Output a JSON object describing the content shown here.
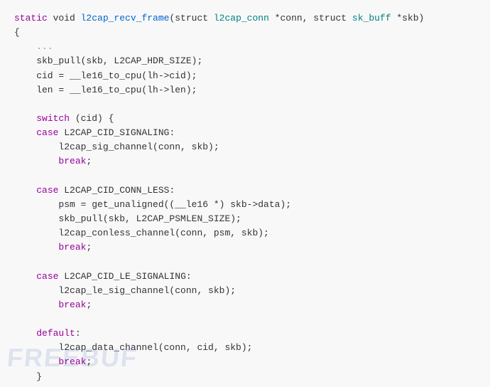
{
  "code": {
    "lines": [
      {
        "tokens": [
          {
            "text": "static",
            "class": "kw-purple"
          },
          {
            "text": " void ",
            "class": "plain"
          },
          {
            "text": "l2cap_recv_frame",
            "class": "func"
          },
          {
            "text": "(struct ",
            "class": "plain"
          },
          {
            "text": "l2cap_conn",
            "class": "type"
          },
          {
            "text": " *conn, struct ",
            "class": "plain"
          },
          {
            "text": "sk_buff",
            "class": "type"
          },
          {
            "text": " *skb)",
            "class": "plain"
          }
        ]
      },
      {
        "tokens": [
          {
            "text": "{",
            "class": "plain"
          }
        ]
      },
      {
        "tokens": [
          {
            "text": "    ...",
            "class": "comment"
          }
        ]
      },
      {
        "tokens": [
          {
            "text": "    skb_pull(skb, L2CAP_HDR_SIZE);",
            "class": "plain"
          }
        ]
      },
      {
        "tokens": [
          {
            "text": "    cid = __le16_to_cpu(lh->cid);",
            "class": "plain"
          }
        ]
      },
      {
        "tokens": [
          {
            "text": "    len = __le16_to_cpu(lh->len);",
            "class": "plain"
          }
        ]
      },
      {
        "tokens": []
      },
      {
        "tokens": [
          {
            "text": "    ",
            "class": "plain"
          },
          {
            "text": "switch",
            "class": "kw-purple"
          },
          {
            "text": " (cid) {",
            "class": "plain"
          }
        ]
      },
      {
        "tokens": [
          {
            "text": "    ",
            "class": "plain"
          },
          {
            "text": "case",
            "class": "kw-purple"
          },
          {
            "text": " L2CAP_CID_SIGNALING:",
            "class": "plain"
          }
        ]
      },
      {
        "tokens": [
          {
            "text": "        l2cap_sig_channel(conn, skb);",
            "class": "plain"
          }
        ]
      },
      {
        "tokens": [
          {
            "text": "        ",
            "class": "plain"
          },
          {
            "text": "break",
            "class": "kw-purple"
          },
          {
            "text": ";",
            "class": "plain"
          }
        ]
      },
      {
        "tokens": []
      },
      {
        "tokens": [
          {
            "text": "    ",
            "class": "plain"
          },
          {
            "text": "case",
            "class": "kw-purple"
          },
          {
            "text": " L2CAP_CID_CONN_LESS:",
            "class": "plain"
          }
        ]
      },
      {
        "tokens": [
          {
            "text": "        psm = get_unaligned((__le16 *) skb->data);",
            "class": "plain"
          }
        ]
      },
      {
        "tokens": [
          {
            "text": "        skb_pull(skb, L2CAP_PSMLEN_SIZE);",
            "class": "plain"
          }
        ]
      },
      {
        "tokens": [
          {
            "text": "        l2cap_conless_channel(conn, psm, skb);",
            "class": "plain"
          }
        ]
      },
      {
        "tokens": [
          {
            "text": "        ",
            "class": "plain"
          },
          {
            "text": "break",
            "class": "kw-purple"
          },
          {
            "text": ";",
            "class": "plain"
          }
        ]
      },
      {
        "tokens": []
      },
      {
        "tokens": [
          {
            "text": "    ",
            "class": "plain"
          },
          {
            "text": "case",
            "class": "kw-purple"
          },
          {
            "text": " L2CAP_CID_LE_SIGNALING:",
            "class": "plain"
          }
        ]
      },
      {
        "tokens": [
          {
            "text": "        l2cap_le_sig_channel(conn, skb);",
            "class": "plain"
          }
        ]
      },
      {
        "tokens": [
          {
            "text": "        ",
            "class": "plain"
          },
          {
            "text": "break",
            "class": "kw-purple"
          },
          {
            "text": ";",
            "class": "plain"
          }
        ]
      },
      {
        "tokens": []
      },
      {
        "tokens": [
          {
            "text": "    ",
            "class": "plain"
          },
          {
            "text": "default",
            "class": "kw-purple"
          },
          {
            "text": ":",
            "class": "plain"
          }
        ]
      },
      {
        "tokens": [
          {
            "text": "        l2cap_data_channel(conn, cid, skb);",
            "class": "plain"
          }
        ]
      },
      {
        "tokens": [
          {
            "text": "        ",
            "class": "plain"
          },
          {
            "text": "break",
            "class": "kw-purple"
          },
          {
            "text": ";",
            "class": "plain"
          }
        ]
      },
      {
        "tokens": [
          {
            "text": "    }",
            "class": "plain"
          }
        ]
      }
    ]
  },
  "watermark": {
    "text": "FREEBUF"
  }
}
